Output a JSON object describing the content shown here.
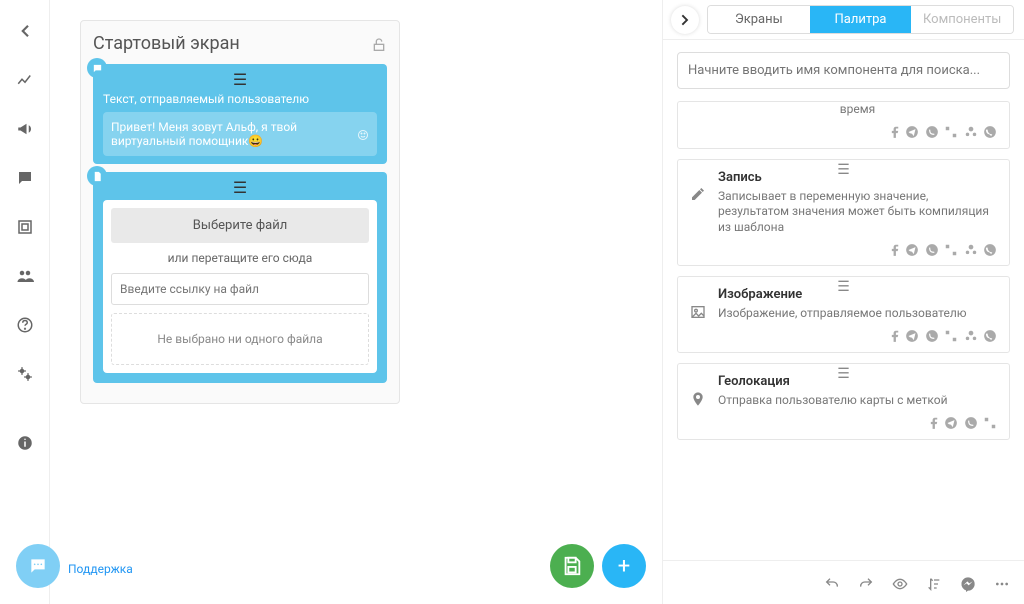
{
  "sidebar": {
    "support_label": "Поддержка"
  },
  "screen": {
    "title": "Стартовый экран",
    "block1_label": "Текст, отправляемый пользователю",
    "block1_msg": "Привет! Меня зовут Альф, я твой виртуальный помощник😀",
    "file_btn": "Выберите файл",
    "file_or": "или перетащите его сюда",
    "file_placeholder": "Введите ссылку на файл",
    "file_empty": "Не выбрано ни одного файла"
  },
  "panel": {
    "tabs": [
      "Экраны",
      "Палитра",
      "Компоненты"
    ],
    "search_placeholder": "Начните вводить имя компонента для поиска...",
    "components": [
      {
        "title": "",
        "desc": "время",
        "icon": "",
        "nets": "fb tg vi vk ok wa"
      },
      {
        "title": "Запись",
        "desc": "Записывает в переменную значение, результатом значения может быть компиляция из шаблона",
        "icon": "pencil",
        "nets": "fb tg vi vk ok wa"
      },
      {
        "title": "Изображение",
        "desc": "Изображение, отправляемое пользователю",
        "icon": "image",
        "nets": "fb tg vi vk ok wa"
      },
      {
        "title": "Геолокация",
        "desc": "Отправка пользователю карты с меткой",
        "icon": "pin",
        "nets": "fb tg vi vk"
      }
    ]
  }
}
